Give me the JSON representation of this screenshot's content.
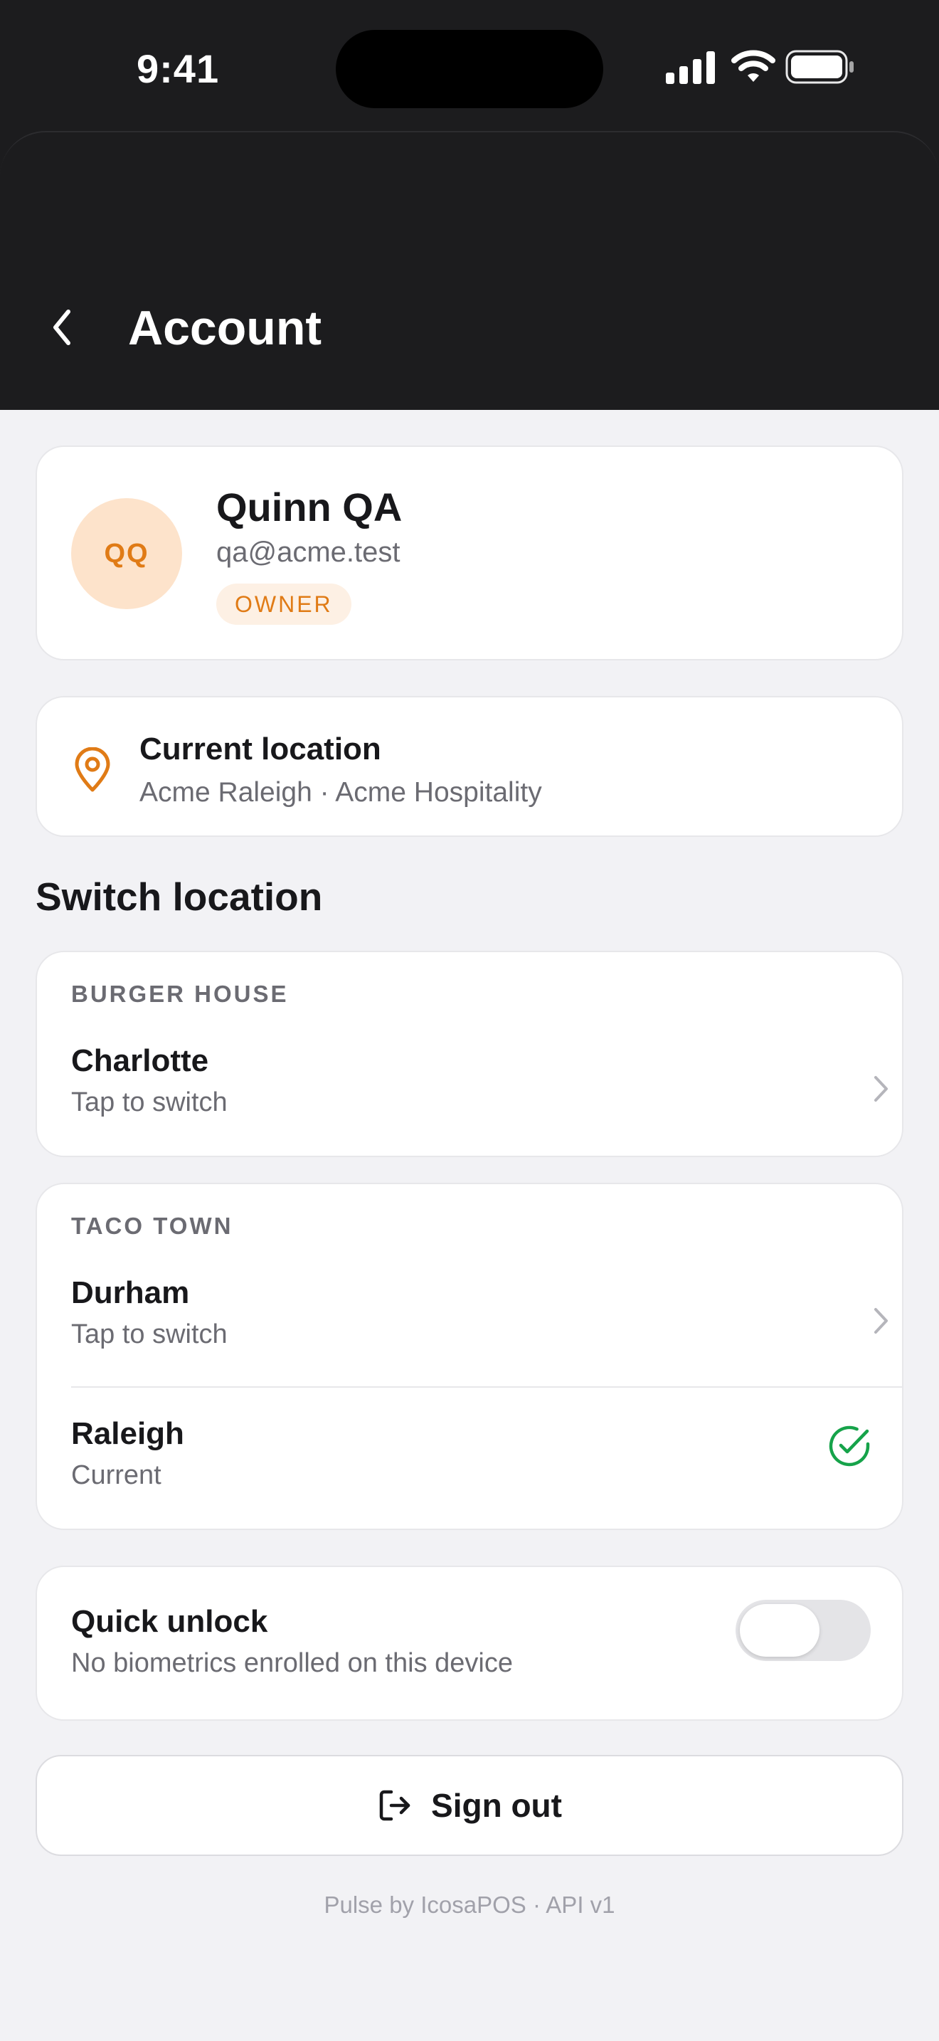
{
  "status_bar": {
    "time": "9:41"
  },
  "nav": {
    "title": "Account",
    "back_icon": "chevron-left-icon"
  },
  "profile": {
    "initials": "QQ",
    "name": "Quinn QA",
    "email": "qa@acme.test",
    "role": "OWNER",
    "avatar_bg": "#fde3cb",
    "accent": "#e07b16"
  },
  "current_location": {
    "title": "Current location",
    "subtitle": "Acme Raleigh · Acme Hospitality",
    "icon": "map-pin-icon"
  },
  "switch_location": {
    "title": "Switch location",
    "groups": [
      {
        "label": "BURGER HOUSE",
        "locations": [
          {
            "name": "Charlotte",
            "status": "Tap to switch",
            "current": false
          }
        ]
      },
      {
        "label": "TACO TOWN",
        "locations": [
          {
            "name": "Durham",
            "status": "Tap to switch",
            "current": false
          },
          {
            "name": "Raleigh",
            "status": "Current",
            "current": true
          }
        ]
      }
    ],
    "current_check_color": "#16a34a"
  },
  "quick_unlock": {
    "title": "Quick unlock",
    "subtitle": "No biometrics enrolled on this device",
    "enabled": false
  },
  "sign_out": {
    "label": "Sign out",
    "icon": "sign-out-icon"
  },
  "footer": {
    "text": "Pulse by IcosaPOS · API v1"
  }
}
